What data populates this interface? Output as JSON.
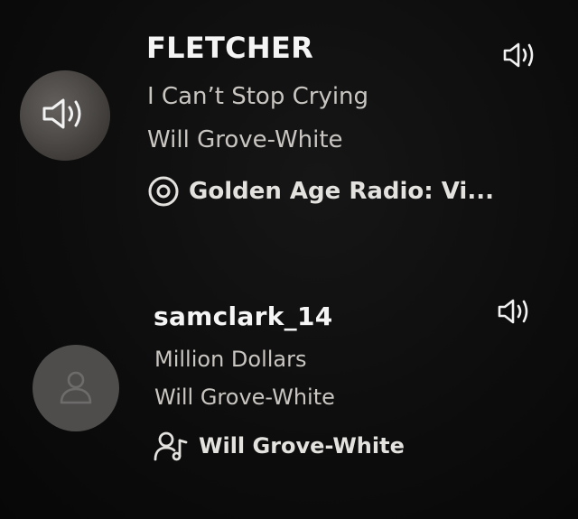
{
  "friends": [
    {
      "name": "FLETCHER",
      "track": "I Can’t Stop Crying",
      "artist": "Will Grove-White",
      "context": "Golden Age Radio: Vi...",
      "context_icon": "radio-icon",
      "avatar": "profile-photo",
      "now_playing_icon": "speaker-icon"
    },
    {
      "name": "samclark_14",
      "track": "Million Dollars",
      "artist": "Will Grove-White",
      "context": "Will Grove-White",
      "context_icon": "artist-icon",
      "avatar": "default-user-icon",
      "now_playing_icon": "speaker-icon"
    }
  ],
  "colors": {
    "background": "#0b0b0b",
    "name": "#f5f5f5",
    "secondary_text": "#c9c6c2",
    "avatar_default": "#4e4d4c"
  }
}
